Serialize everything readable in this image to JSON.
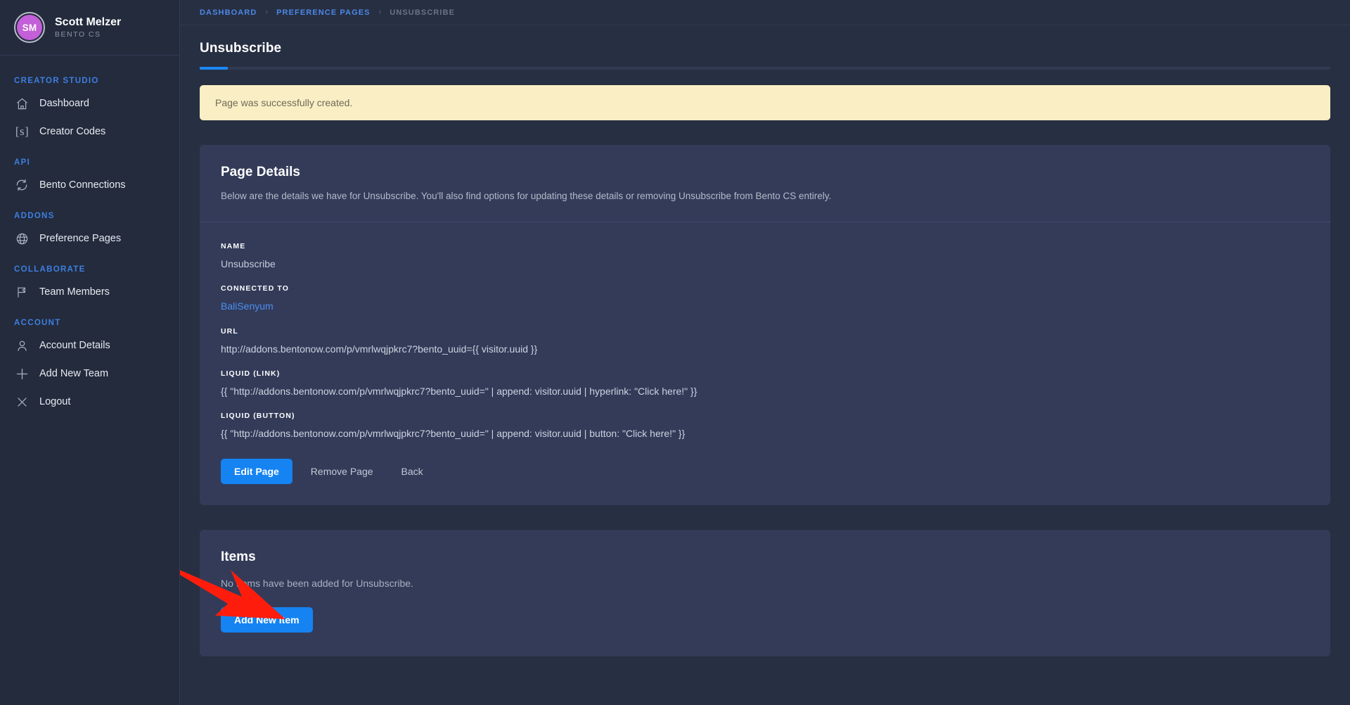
{
  "sidebar": {
    "user": {
      "initials": "SM",
      "name": "Scott Melzer",
      "org": "BENTO CS"
    },
    "sections": [
      {
        "title": "CREATOR STUDIO",
        "items": [
          {
            "label": "Dashboard",
            "icon": "home-icon"
          },
          {
            "label": "Creator Codes",
            "icon": "code-brackets-icon"
          }
        ]
      },
      {
        "title": "API",
        "items": [
          {
            "label": "Bento Connections",
            "icon": "refresh-sync-icon"
          }
        ]
      },
      {
        "title": "ADDONS",
        "items": [
          {
            "label": "Preference Pages",
            "icon": "globe-icon"
          }
        ]
      },
      {
        "title": "COLLABORATE",
        "items": [
          {
            "label": "Team Members",
            "icon": "flag-icon"
          }
        ]
      },
      {
        "title": "ACCOUNT",
        "items": [
          {
            "label": "Account Details",
            "icon": "person-icon"
          },
          {
            "label": "Add New Team",
            "icon": "plus-icon"
          },
          {
            "label": "Logout",
            "icon": "close-x-icon"
          }
        ]
      }
    ]
  },
  "breadcrumb": {
    "items": [
      "DASHBOARD",
      "PREFERENCE PAGES",
      "UNSUBSCRIBE"
    ],
    "separator": "›"
  },
  "page": {
    "title": "Unsubscribe"
  },
  "alert": {
    "message": "Page was successfully created."
  },
  "page_details": {
    "title": "Page Details",
    "description": "Below are the details we have for Unsubscribe. You'll also find options for updating these details or removing Unsubscribe from Bento CS entirely.",
    "fields": [
      {
        "label": "NAME",
        "value": "Unsubscribe"
      },
      {
        "label": "CONNECTED TO",
        "value": "BaliSenyum"
      },
      {
        "label": "URL",
        "value": "http://addons.bentonow.com/p/vmrlwqjpkrc7?bento_uuid={{ visitor.uuid }}"
      },
      {
        "label": "LIQUID (LINK)",
        "value": "{{ \"http://addons.bentonow.com/p/vmrlwqjpkrc7?bento_uuid=\" | append: visitor.uuid | hyperlink: \"Click here!\" }}"
      },
      {
        "label": "LIQUID (BUTTON)",
        "value": "{{ \"http://addons.bentonow.com/p/vmrlwqjpkrc7?bento_uuid=\" | append: visitor.uuid | button: \"Click here!\" }}"
      }
    ],
    "buttons": {
      "edit": "Edit Page",
      "remove": "Remove Page",
      "back": "Back"
    }
  },
  "items_section": {
    "title": "Items",
    "empty_message": "No Items have been added for Unsubscribe.",
    "add_button": "Add New Item"
  },
  "colors": {
    "accent_blue": "#1583f2",
    "link_blue": "#4c8ff0",
    "section_blue": "#3e7fe0",
    "alert_bg": "#faeec4",
    "avatar_purple": "#c35fd8",
    "arrow_red": "#fe1d0c",
    "page_bg": "#272f42",
    "sidebar_bg": "#232b3d",
    "card_bg": "#333b59"
  }
}
